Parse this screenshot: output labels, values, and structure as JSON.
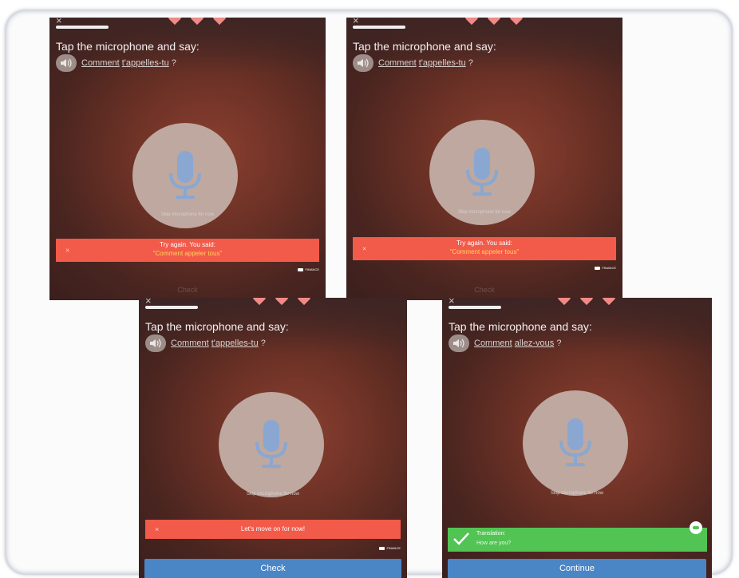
{
  "common": {
    "close_icon": "×",
    "prompt": "Tap the microphone and say:",
    "skip": "Skip microphone for now",
    "logo_text": "FINANCE",
    "colors": {
      "error_banner": "#f25a49",
      "success_banner": "#52c454",
      "button": "#4a86c6",
      "mic_circle": "#bea89f",
      "mic_icon": "#8aa7d1",
      "heart": "#f08a86"
    }
  },
  "screens": [
    {
      "phrase_words": [
        "Comment",
        "t'appelles-tu"
      ],
      "phrase_end": "?",
      "feedback_title": "Try again. You said:",
      "feedback_heard": "\"Comment appeler tous\"",
      "feedback_close": "×",
      "button_label": "Check"
    },
    {
      "phrase_words": [
        "Comment",
        "t'appelles-tu"
      ],
      "phrase_end": "?",
      "feedback_title": "Try again. You said:",
      "feedback_heard": "\"Comment appeler tous\"",
      "feedback_close": "×",
      "button_label": "Check"
    },
    {
      "phrase_words": [
        "Comment",
        "t'appelles-tu"
      ],
      "phrase_end": "?",
      "feedback_title": "Let's move on for now!",
      "feedback_close": "×",
      "button_label": "Check"
    },
    {
      "phrase_words": [
        "Comment",
        "allez-vous"
      ],
      "phrase_end": "?",
      "translation_label": "Translation:",
      "translation_text": "How are you?",
      "button_label": "Continue"
    }
  ]
}
